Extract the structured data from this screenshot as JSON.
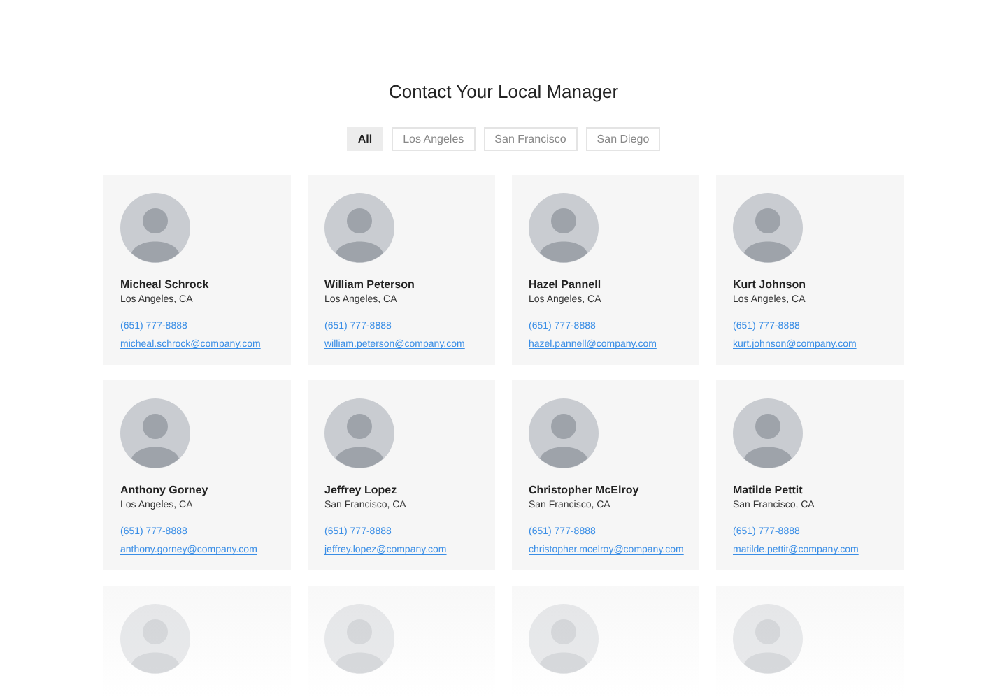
{
  "title": "Contact Your Local Manager",
  "filters": [
    {
      "label": "All",
      "selected": true
    },
    {
      "label": "Los Angeles",
      "selected": false
    },
    {
      "label": "San Francisco",
      "selected": false
    },
    {
      "label": "San Diego",
      "selected": false
    }
  ],
  "contacts": [
    {
      "kind": "full",
      "name": "Micheal Schrock",
      "location": "Los Angeles, CA",
      "phone": "(651) 777-8888",
      "email": "micheal.schrock@company.com"
    },
    {
      "kind": "full",
      "name": "William Peterson",
      "location": "Los Angeles, CA",
      "phone": "(651) 777-8888",
      "email": "william.peterson@company.com"
    },
    {
      "kind": "full",
      "name": "Hazel Pannell",
      "location": "Los Angeles, CA",
      "phone": "(651) 777-8888",
      "email": "hazel.pannell@company.com"
    },
    {
      "kind": "full",
      "name": "Kurt Johnson",
      "location": "Los Angeles, CA",
      "phone": "(651) 777-8888",
      "email": "kurt.johnson@company.com"
    },
    {
      "kind": "full",
      "name": "Anthony Gorney",
      "location": "Los Angeles, CA",
      "phone": "(651) 777-8888",
      "email": "anthony.gorney@company.com"
    },
    {
      "kind": "full",
      "name": "Jeffrey Lopez",
      "location": "San Francisco, CA",
      "phone": "(651) 777-8888",
      "email": "jeffrey.lopez@company.com"
    },
    {
      "kind": "full",
      "name": "Christopher McElroy",
      "location": "San Francisco, CA",
      "phone": "(651) 777-8888",
      "email": "christopher.mcelroy@company.com"
    },
    {
      "kind": "full",
      "name": "Matilde Pettit",
      "location": "San Francisco, CA",
      "phone": "(651) 777-8888",
      "email": "matilde.pettit@company.com"
    },
    {
      "kind": "faded"
    },
    {
      "kind": "faded"
    },
    {
      "kind": "faded"
    },
    {
      "kind": "faded"
    }
  ]
}
